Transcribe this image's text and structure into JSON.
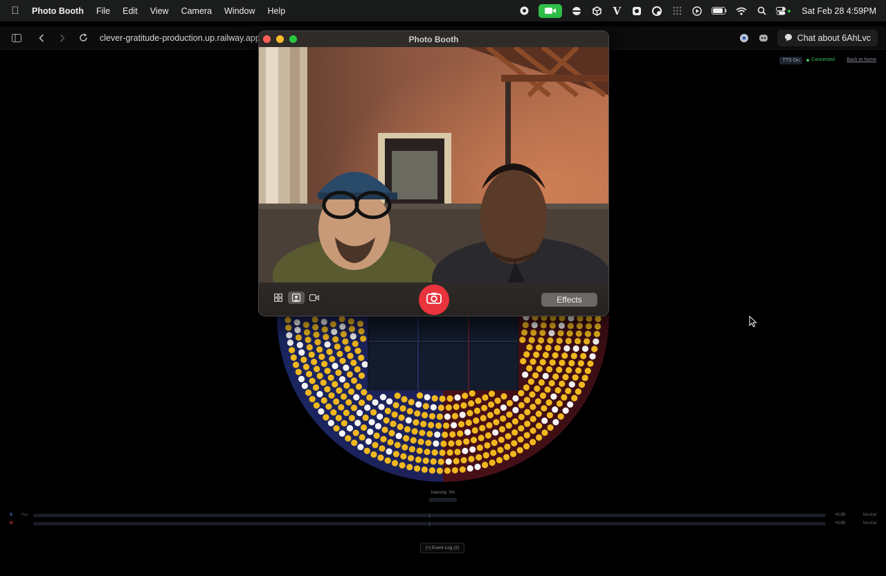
{
  "menubar": {
    "app_name": "Photo Booth",
    "items": [
      "File",
      "Edit",
      "View",
      "Camera",
      "Window",
      "Help"
    ],
    "clock": "Sat Feb 28  4:59PM"
  },
  "browser": {
    "url": "clever-gratitude-production.up.railway.app",
    "chat_button": "Chat about 6AhLvc"
  },
  "page": {
    "tts": "TTS On",
    "status": "Connected",
    "back_link": "Back to home",
    "intensity_label": "Intensity: 0%",
    "tracks": [
      {
        "symbol": "X",
        "sub": "You",
        "value": "+0.00",
        "state": "Neutral",
        "color": "#4a7bd8"
      },
      {
        "symbol": "O",
        "sub": "",
        "value": "+0.00",
        "state": "Neutral",
        "color": "#d84a4a"
      }
    ],
    "event_log": "[+] Event Log (2)"
  },
  "photobooth": {
    "title": "Photo Booth",
    "effects_label": "Effects",
    "colors": {
      "close": "#ff5f57",
      "minimize": "#febc2e",
      "zoom": "#28c840",
      "shutter": "#e9333d"
    }
  }
}
